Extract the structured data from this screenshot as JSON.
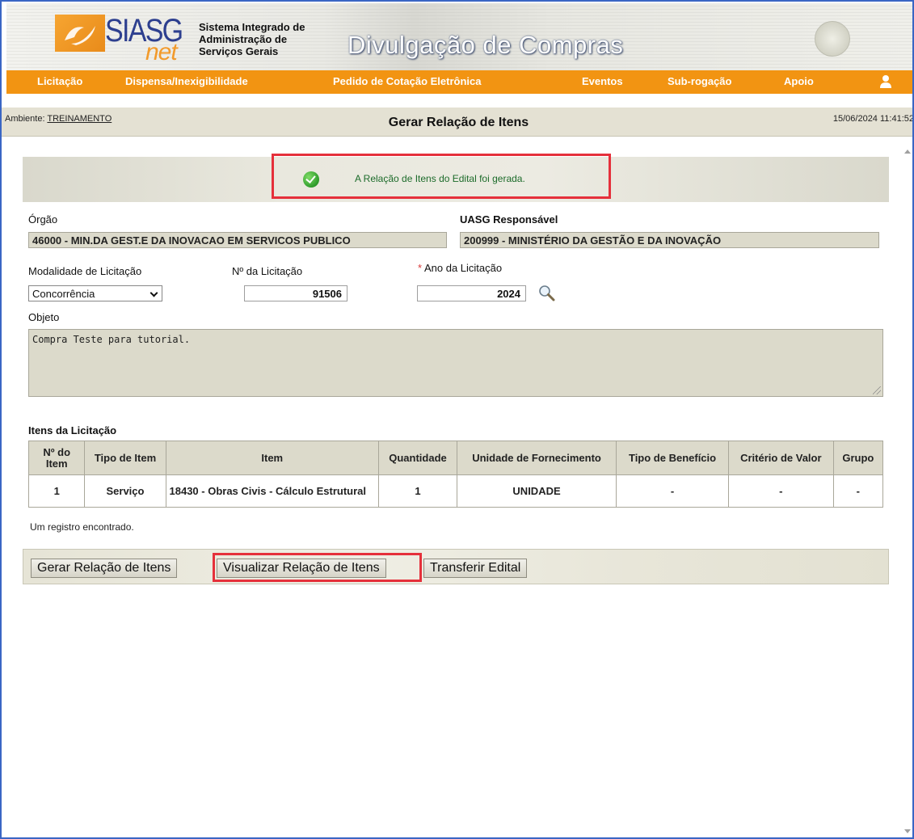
{
  "header": {
    "logo_text": "SIASG",
    "logo_suffix": "net",
    "system_name_line1": "Sistema Integrado de",
    "system_name_line2": "Administração de",
    "system_name_line3": "Serviços Gerais",
    "portal_title": "Divulgação de Compras"
  },
  "menu": {
    "items": [
      {
        "label": "Licitação"
      },
      {
        "label": "Dispensa/Inexigibilidade"
      },
      {
        "label": "Pedido de Cotação Eletrônica"
      },
      {
        "label": "Eventos"
      },
      {
        "label": "Sub-rogação"
      },
      {
        "label": "Apoio"
      }
    ],
    "user_icon": "user-icon"
  },
  "infobar": {
    "ambiente_label": "Ambiente:",
    "ambiente_value": "TREINAMENTO",
    "page_title": "Gerar Relação de Itens",
    "datetime": "15/06/2024 11:41:52"
  },
  "message": {
    "icon": "check-circle-icon",
    "text": "A Relação de Itens do Edital foi gerada.",
    "color": "#1c6b2a"
  },
  "form": {
    "orgao_label": "Órgão",
    "orgao_value": "46000 - MIN.DA GEST.E DA INOVACAO EM SERVICOS PUBLICO",
    "uasg_label": "UASG Responsável",
    "uasg_value": "200999 - MINISTÉRIO DA GESTÃO E DA INOVAÇÃO",
    "modalidade_label": "Modalidade de Licitação",
    "modalidade_value": "Concorrência",
    "numero_label": "Nº da Licitação",
    "numero_value": "91506",
    "ano_required_mark": "*",
    "ano_label": "Ano da Licitação",
    "ano_value": "2024",
    "objeto_label": "Objeto",
    "objeto_value": "Compra Teste para tutorial."
  },
  "items_section": {
    "title": "Itens da Licitação",
    "columns": {
      "numero": "Nº do Item",
      "tipo": "Tipo de Item",
      "item": "Item",
      "quantidade": "Quantidade",
      "unidade": "Unidade de Fornecimento",
      "beneficio": "Tipo de Benefício",
      "criterio": "Critério de Valor",
      "grupo": "Grupo"
    },
    "rows": [
      {
        "numero": "1",
        "tipo": "Serviço",
        "item": "18430 - Obras Civis - Cálculo Estrutural",
        "quantidade": "1",
        "unidade": "UNIDADE",
        "beneficio": "-",
        "criterio": "-",
        "grupo": "-"
      }
    ],
    "record_count": "Um registro encontrado."
  },
  "buttons": {
    "gerar": "Gerar Relação de Itens",
    "visualizar": "Visualizar Relação de Itens",
    "transferir": "Transferir Edital"
  },
  "colors": {
    "menu_bar": "#f29412",
    "highlight": "#e5303b",
    "accent_blue": "#2d3f8f"
  }
}
